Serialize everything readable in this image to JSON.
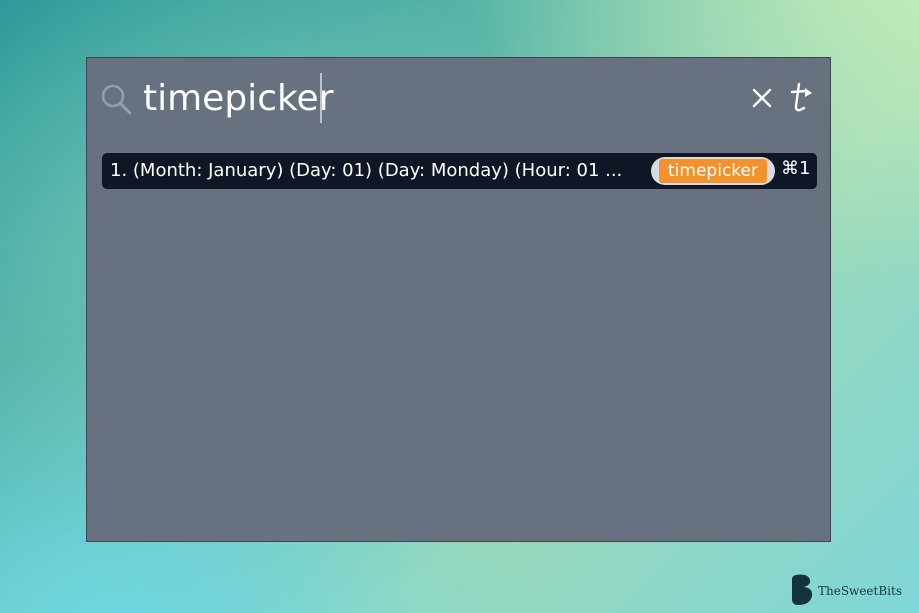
{
  "search": {
    "value": "timepicker",
    "icon": "search-icon"
  },
  "header_buttons": {
    "clear_icon": "close-icon",
    "tag_icon": "tag-icon"
  },
  "results": [
    {
      "text": "1. (Month: January) (Day: 01) (Day: Monday) (Hour: 01 ...",
      "tag": "timepicker",
      "shortcut": "⌘1"
    }
  ],
  "watermark": {
    "name": "TheSweetBits"
  },
  "colors": {
    "panel": "#67717f",
    "result_bg": "#0f1726",
    "tag_accent": "#f3922b"
  }
}
